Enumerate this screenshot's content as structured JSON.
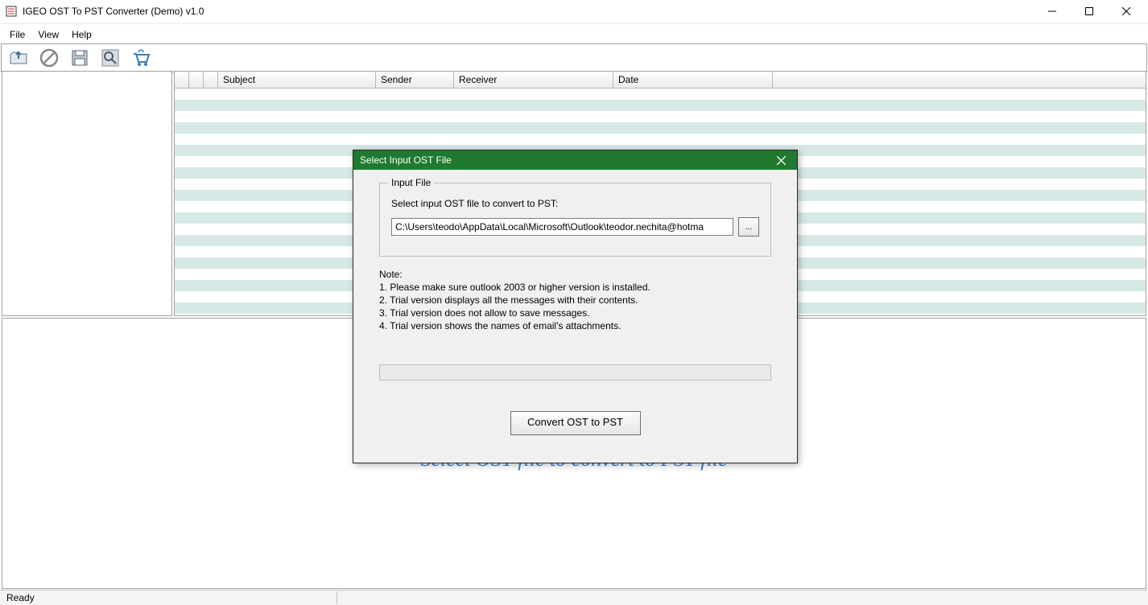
{
  "window": {
    "title": "IGEO OST To PST Converter (Demo) v1.0"
  },
  "menu": {
    "file": "File",
    "view": "View",
    "help": "Help"
  },
  "toolbar_icons": {
    "open": "open-folder-icon",
    "stop": "stop-icon",
    "save": "save-icon",
    "search": "search-icon",
    "cart": "cart-icon"
  },
  "grid": {
    "columns": {
      "subject": "Subject",
      "sender": "Sender",
      "receiver": "Receiver",
      "date": "Date"
    }
  },
  "placeholder_text": "Select OST file to convert to PST file",
  "status": {
    "ready": "Ready"
  },
  "dialog": {
    "title": "Select Input OST File",
    "fieldset_legend": "Input File",
    "select_label": "Select input OST file to convert to PST:",
    "path_value": "C:\\Users\\teodo\\AppData\\Local\\Microsoft\\Outlook\\teodor.nechita@hotma",
    "browse_label": "...",
    "note_header": "Note:",
    "note1": "1. Please make sure outlook 2003 or higher version is installed.",
    "note2": "2. Trial version displays all the messages with their contents.",
    "note3": "3. Trial version does not allow to save messages.",
    "note4": "4. Trial version shows the names of email's attachments.",
    "convert_button": "Convert OST to PST"
  }
}
